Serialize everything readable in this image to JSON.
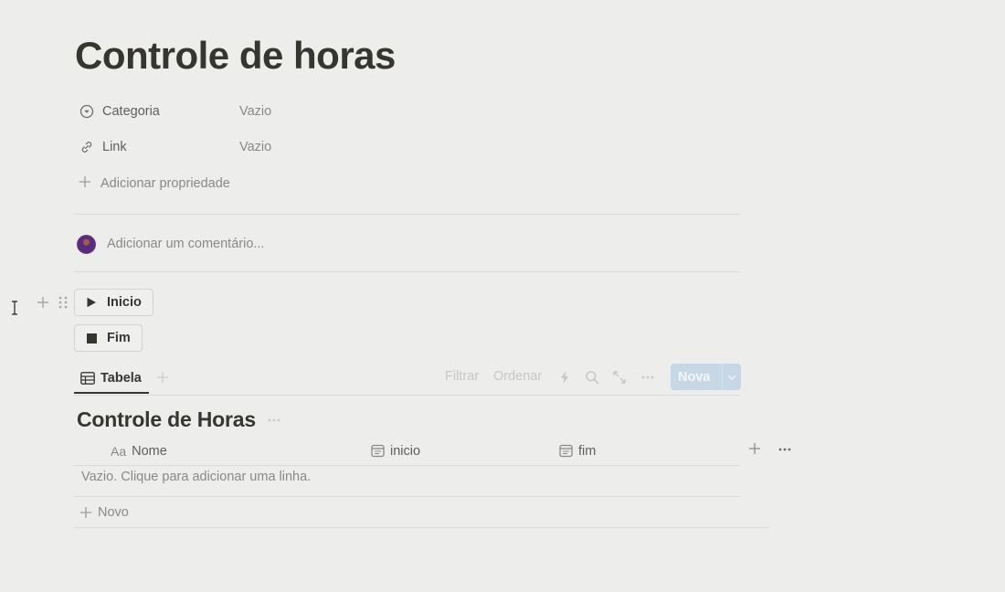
{
  "page": {
    "title": "Controle de horas"
  },
  "properties": [
    {
      "name": "Categoria",
      "value": "Vazio",
      "icon": "select-icon"
    },
    {
      "name": "Link",
      "value": "Vazio",
      "icon": "link-icon"
    }
  ],
  "add_property_label": "Adicionar propriedade",
  "comment": {
    "placeholder": "Adicionar um comentário..."
  },
  "buttons": [
    {
      "label": "Inicio",
      "icon": "play-icon"
    },
    {
      "label": "Fim",
      "icon": "stop-icon"
    }
  ],
  "view": {
    "tab_label": "Tabela",
    "filter_label": "Filtrar",
    "sort_label": "Ordenar",
    "new_label": "Nova"
  },
  "database": {
    "title": "Controle de Horas",
    "columns": [
      {
        "label": "Nome",
        "icon": "text-icon",
        "icon_text": "Aa"
      },
      {
        "label": "inicio",
        "icon": "calendar-icon"
      },
      {
        "label": "fim",
        "icon": "calendar-icon"
      }
    ],
    "empty_message": "Vazio. Clique para adicionar uma linha.",
    "new_row_label": "Novo"
  },
  "colors": {
    "background": "#ededec",
    "text": "#37352f",
    "muted": "#8a8986",
    "new_button": "#c7d7e6"
  }
}
